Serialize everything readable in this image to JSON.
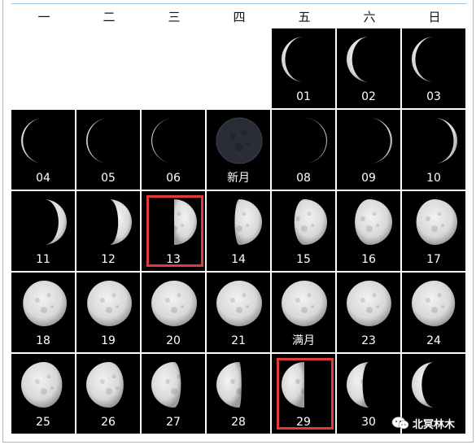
{
  "weekday_headers": [
    "一",
    "二",
    "三",
    "四",
    "五",
    "六",
    "日"
  ],
  "days": [
    {
      "label": "01",
      "phase": 0.08,
      "dir": "wane"
    },
    {
      "label": "02",
      "phase": 0.12,
      "dir": "wane"
    },
    {
      "label": "03",
      "phase": 0.08,
      "dir": "wane"
    },
    {
      "label": "04",
      "phase": 0.04,
      "dir": "wane"
    },
    {
      "label": "05",
      "phase": 0.03,
      "dir": "wane"
    },
    {
      "label": "06",
      "phase": 0.02,
      "dir": "wane"
    },
    {
      "label": "新月",
      "phase": 0.0,
      "dir": "new"
    },
    {
      "label": "08",
      "phase": 0.02,
      "dir": "wax"
    },
    {
      "label": "09",
      "phase": 0.04,
      "dir": "wax"
    },
    {
      "label": "10",
      "phase": 0.08,
      "dir": "wax"
    },
    {
      "label": "11",
      "phase": 0.18,
      "dir": "wax"
    },
    {
      "label": "12",
      "phase": 0.3,
      "dir": "wax"
    },
    {
      "label": "13",
      "phase": 0.5,
      "dir": "wax"
    },
    {
      "label": "14",
      "phase": 0.6,
      "dir": "wax"
    },
    {
      "label": "15",
      "phase": 0.72,
      "dir": "wax"
    },
    {
      "label": "16",
      "phase": 0.82,
      "dir": "wax"
    },
    {
      "label": "17",
      "phase": 0.9,
      "dir": "wax"
    },
    {
      "label": "18",
      "phase": 0.96,
      "dir": "wax"
    },
    {
      "label": "19",
      "phase": 0.98,
      "dir": "wax"
    },
    {
      "label": "20",
      "phase": 1.0,
      "dir": "full"
    },
    {
      "label": "21",
      "phase": 1.0,
      "dir": "full"
    },
    {
      "label": "满月",
      "phase": 1.0,
      "dir": "full"
    },
    {
      "label": "23",
      "phase": 0.98,
      "dir": "wane"
    },
    {
      "label": "24",
      "phase": 0.95,
      "dir": "wane"
    },
    {
      "label": "25",
      "phase": 0.9,
      "dir": "wane"
    },
    {
      "label": "26",
      "phase": 0.82,
      "dir": "wane"
    },
    {
      "label": "27",
      "phase": 0.65,
      "dir": "wane"
    },
    {
      "label": "28",
      "phase": 0.55,
      "dir": "wane"
    },
    {
      "label": "29",
      "phase": 0.5,
      "dir": "wane"
    },
    {
      "label": "30",
      "phase": 0.35,
      "dir": "wane"
    },
    {
      "label": "",
      "phase": 0.22,
      "dir": "wane"
    }
  ],
  "highlighted": [
    "13",
    "29"
  ],
  "watermark": {
    "text": "北冥林木",
    "icon": "wechat-icon"
  },
  "colors": {
    "highlight": "#e23b3b",
    "cell_bg": "#000000",
    "moon": "#d8d8d8"
  }
}
